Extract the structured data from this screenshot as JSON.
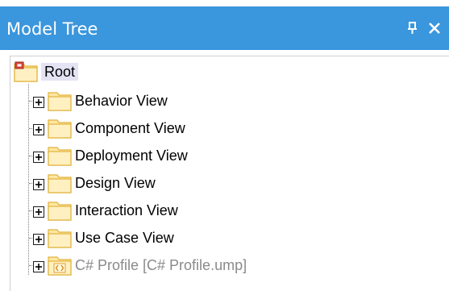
{
  "window": {
    "title": "Model Tree",
    "title_bar_color": "#3a96dd",
    "buttons": [
      {
        "name": "pin",
        "icon": "pin-icon"
      },
      {
        "name": "close",
        "icon": "close-icon"
      }
    ]
  },
  "tree": {
    "root": {
      "label": "Root",
      "icon": "root-folder-icon"
    },
    "children": [
      {
        "label": "Behavior View",
        "icon": "folder-icon",
        "expandable": true
      },
      {
        "label": "Component View",
        "icon": "folder-icon",
        "expandable": true
      },
      {
        "label": "Deployment View",
        "icon": "folder-icon",
        "expandable": true
      },
      {
        "label": "Design View",
        "icon": "folder-icon",
        "expandable": true
      },
      {
        "label": "Interaction View",
        "icon": "folder-icon",
        "expandable": true
      },
      {
        "label": "Use Case View",
        "icon": "folder-icon",
        "expandable": true
      },
      {
        "label": "C# Profile [C# Profile.ump]",
        "icon": "profile-folder-icon",
        "expandable": true,
        "disabled": true
      }
    ]
  },
  "colors": {
    "folder_fill": "#ffe7a3",
    "folder_stroke": "#e0b23a",
    "profile_text": "#8a8a8a",
    "root_highlight": "#e3e3f4"
  }
}
